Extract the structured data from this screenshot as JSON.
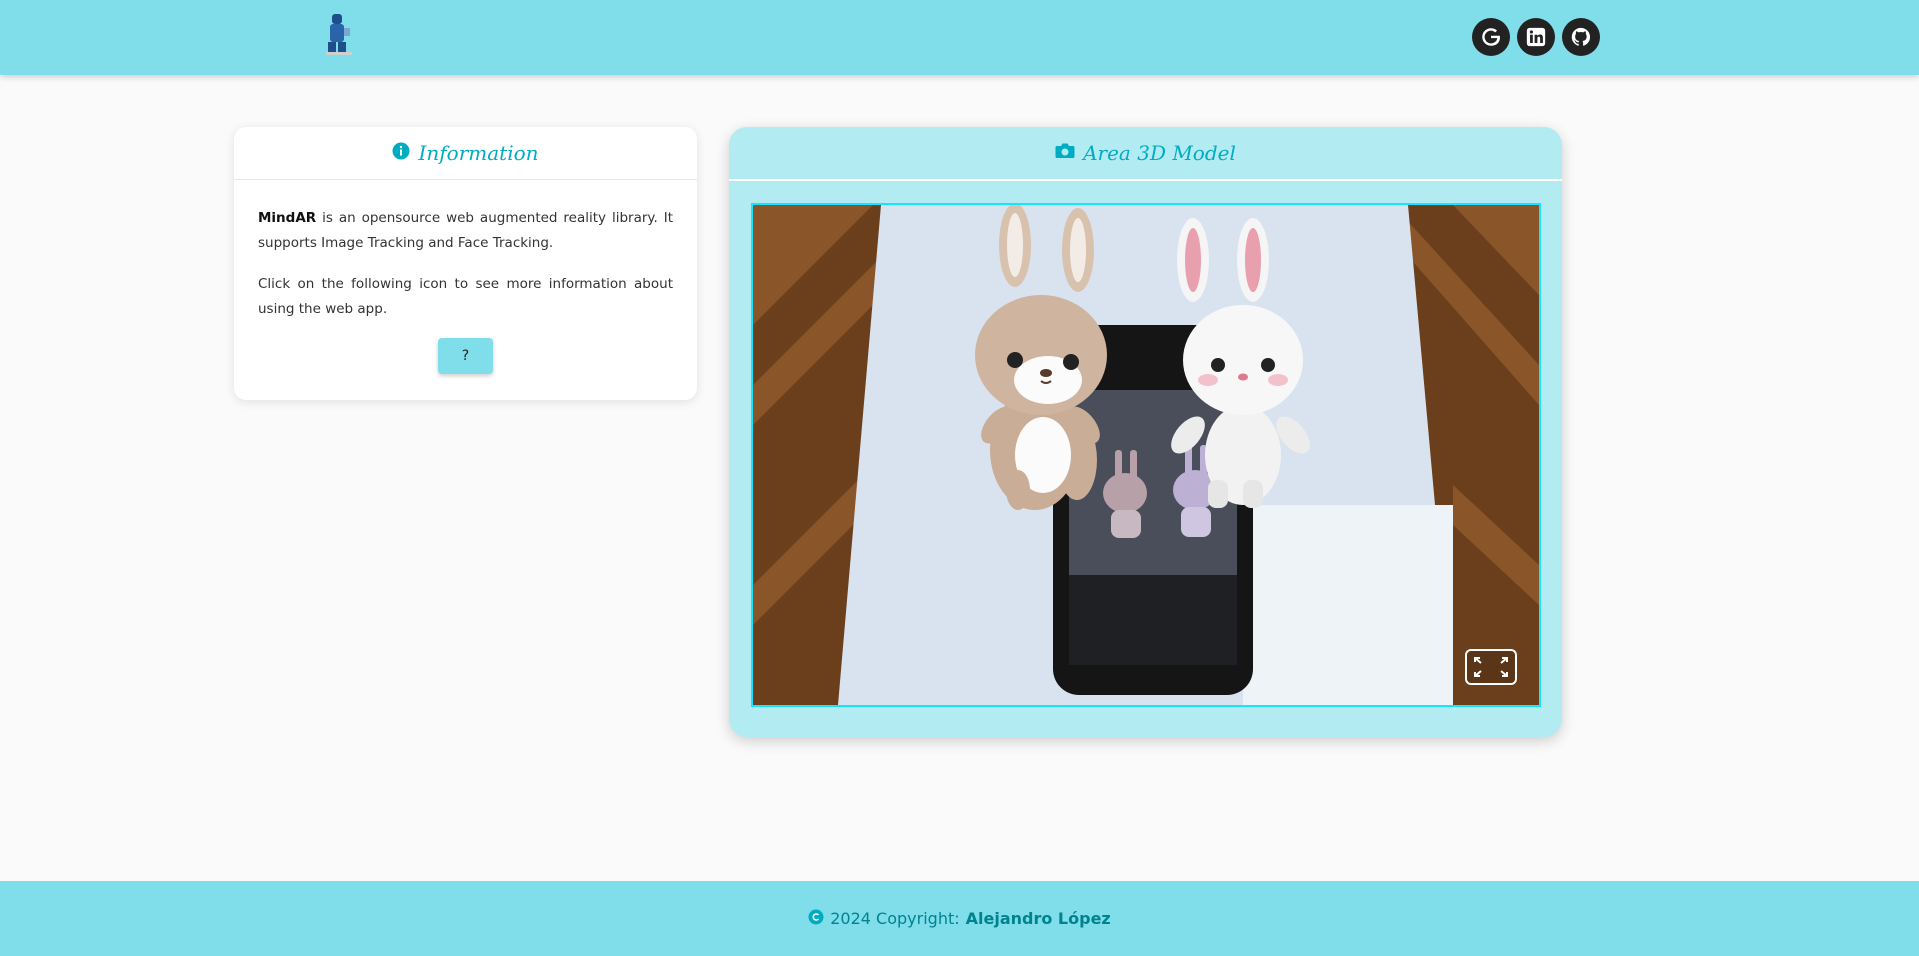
{
  "header": {
    "social": [
      {
        "icon": "google-icon",
        "label": "G"
      },
      {
        "icon": "linkedin-icon",
        "label": "in"
      },
      {
        "icon": "github-icon",
        "label": "GitHub"
      }
    ]
  },
  "info_card": {
    "title": "Information",
    "brand": "MindAR",
    "paragraph1": " is an opensource web augmented reality library. It supports Image Tracking and Face Tracking.",
    "paragraph2": "Click on the following icon to see more information about using the web app.",
    "help_button": "?"
  },
  "model_card": {
    "title": "Area 3D Model"
  },
  "footer": {
    "text": "2024 Copyright:",
    "author": "Alejandro López"
  },
  "colors": {
    "header_bg": "#80deea",
    "accent": "#00acc1",
    "model_card_bg": "#b2ebf2",
    "viewport_border": "#18e4ff"
  }
}
